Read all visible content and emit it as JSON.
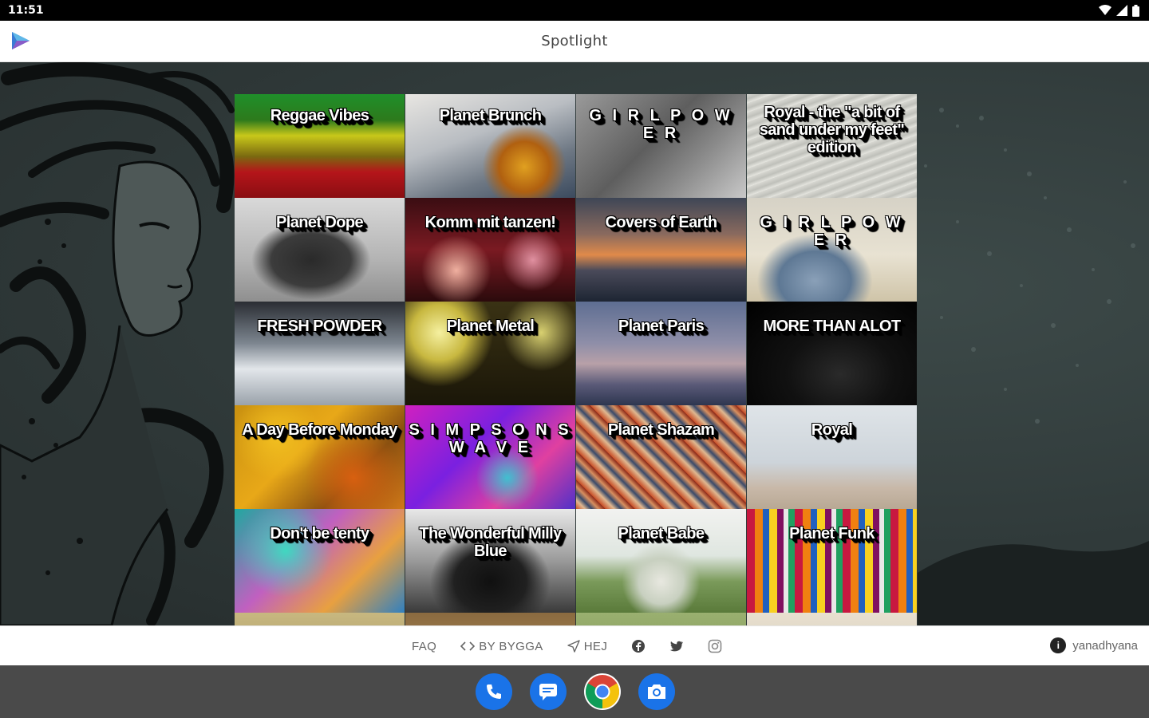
{
  "status_bar": {
    "time": "11:51"
  },
  "app_bar": {
    "title": "Spotlight",
    "logo_icon": "app-logo-icon"
  },
  "playlists": [
    {
      "label": "Reggae Vibes"
    },
    {
      "label": "Planet Brunch"
    },
    {
      "label": "G I R L P O W E R"
    },
    {
      "label": "Royal - the \"a bit of sand under my feet\" edition"
    },
    {
      "label": "Planet Dope"
    },
    {
      "label": "Komm mit tanzen!"
    },
    {
      "label": "Covers of Earth"
    },
    {
      "label": "G I R L P O W E R"
    },
    {
      "label": "FRESH POWDER"
    },
    {
      "label": "Planet Metal"
    },
    {
      "label": "Planet Paris"
    },
    {
      "label": "MORE THAN ALOT"
    },
    {
      "label": "A Day Before Monday"
    },
    {
      "label": "S I M P S O N S W A V E"
    },
    {
      "label": "Planet Shazam"
    },
    {
      "label": "Royal"
    },
    {
      "label": "Don't be tenty"
    },
    {
      "label": "The Wonderful Milly Blue"
    },
    {
      "label": "Planet Babe"
    },
    {
      "label": "Planet Funk"
    }
  ],
  "footer": {
    "faq": "FAQ",
    "by_bygga": "BY BYGGA",
    "hej": "HEJ",
    "username": "yanadhyana",
    "user_initial": "i",
    "social_icons": [
      "facebook-icon",
      "twitter-icon",
      "instagram-icon"
    ]
  },
  "dock": {
    "apps": [
      "phone-icon",
      "messages-icon",
      "chrome-icon",
      "camera-icon"
    ]
  },
  "colors": {
    "accent_blue": "#1a73e8",
    "background_dark": "#303a3a"
  }
}
